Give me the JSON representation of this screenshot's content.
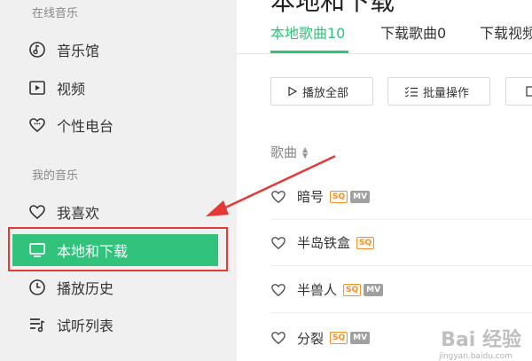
{
  "sidebar": {
    "section_online": "在线音乐",
    "online_items": [
      {
        "label": "音乐馆",
        "icon": "music-hall-icon"
      },
      {
        "label": "视频",
        "icon": "video-icon"
      },
      {
        "label": "个性电台",
        "icon": "radio-heart-icon"
      }
    ],
    "section_mine": "我的音乐",
    "mine_items": [
      {
        "label": "我喜欢",
        "icon": "heart-icon"
      },
      {
        "label": "本地和下载",
        "icon": "monitor-icon",
        "active": true
      },
      {
        "label": "播放历史",
        "icon": "clock-icon"
      },
      {
        "label": "试听列表",
        "icon": "playlist-icon"
      }
    ]
  },
  "main": {
    "title": "本地和下载",
    "tabs": [
      {
        "label": "本地歌曲10",
        "active": true
      },
      {
        "label": "下载歌曲0"
      },
      {
        "label": "下载视频"
      }
    ],
    "toolbar": {
      "play_all": "播放全部",
      "batch": "批量操作"
    },
    "column_header": "歌曲",
    "songs": [
      {
        "name": "暗号",
        "sq": "SQ",
        "mv": "MV"
      },
      {
        "name": "半岛铁盒",
        "sq": "SQ",
        "mv": ""
      },
      {
        "name": "半兽人",
        "sq": "SQ",
        "mv": "MV"
      },
      {
        "name": "分裂",
        "sq": "SQ",
        "mv": "MV"
      }
    ]
  },
  "watermark": {
    "text": "Bai 经验",
    "url": "jingyan.baidu.com"
  },
  "colors": {
    "accent": "#31c27c",
    "highlight": "#e53935",
    "sidebar_bg": "#f0f0f0"
  }
}
